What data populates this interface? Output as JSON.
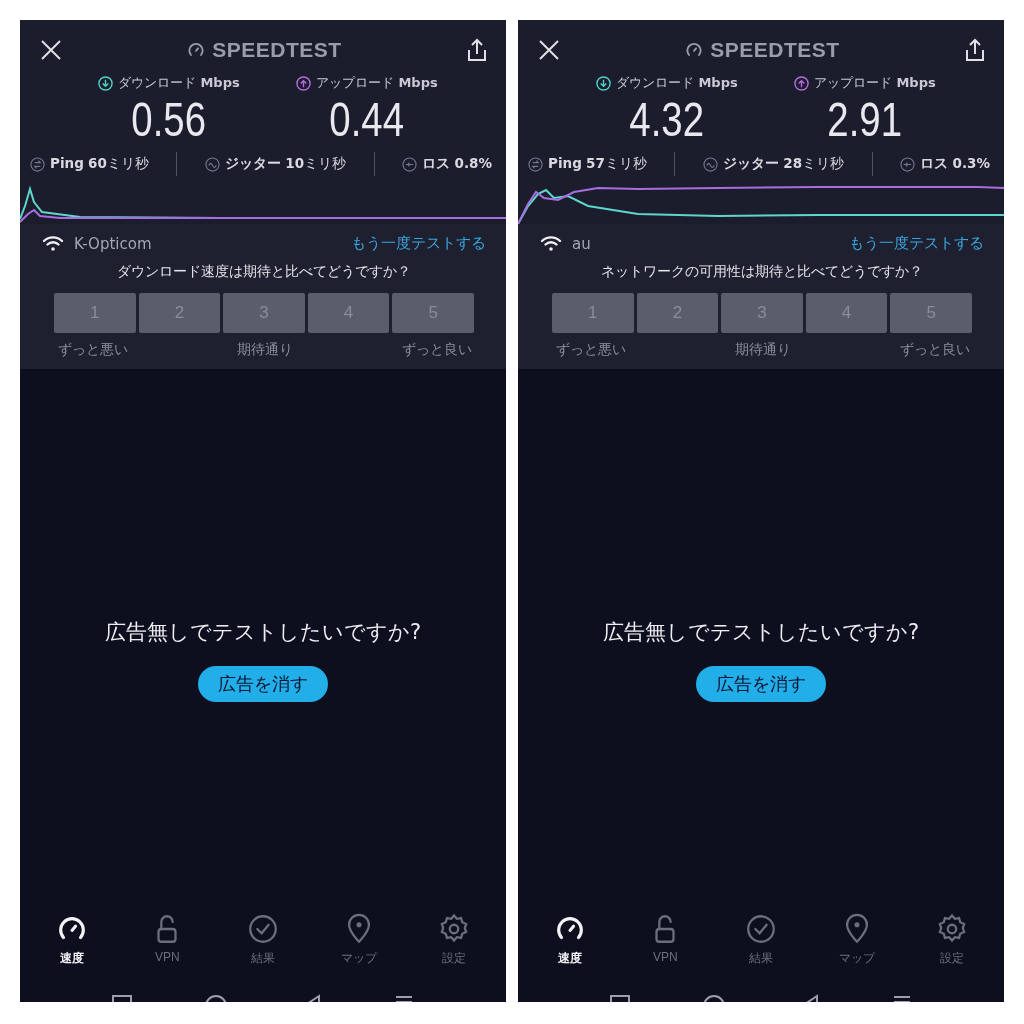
{
  "screens": [
    {
      "title": "SPEEDTEST",
      "download": {
        "label": "ダウンロード",
        "unit": "Mbps",
        "value": "0.56"
      },
      "upload": {
        "label": "アップロード",
        "unit": "Mbps",
        "value": "0.44"
      },
      "stats": [
        {
          "label": "Ping",
          "value": "**60**ミリ秒"
        },
        {
          "label": "ジッター",
          "value": "**10**ミリ秒"
        },
        {
          "label": "ロス",
          "value": "**0.8%**"
        }
      ],
      "network": "K-Opticom",
      "retest": "もう一度テストする",
      "question": "ダウンロード速度は期待と比べてどうですか？",
      "ratings": [
        "1",
        "2",
        "3",
        "4",
        "5"
      ],
      "scale": [
        "ずっと悪い",
        "期待通り",
        "ずっと良い"
      ],
      "ad_prompt": "広告無しでテストしたいですか?",
      "ad_button": "広告を消す",
      "nav": [
        {
          "label": "速度",
          "selected": true
        },
        {
          "label": "VPN",
          "selected": false
        },
        {
          "label": "結果",
          "selected": false
        },
        {
          "label": "マップ",
          "selected": false
        },
        {
          "label": "設定",
          "selected": false
        }
      ]
    },
    {
      "title": "SPEEDTEST",
      "download": {
        "label": "ダウンロード",
        "unit": "Mbps",
        "value": "4.32"
      },
      "upload": {
        "label": "アップロード",
        "unit": "Mbps",
        "value": "2.91"
      },
      "stats": [
        {
          "label": "Ping",
          "value": "**57**ミリ秒"
        },
        {
          "label": "ジッター",
          "value": "**28**ミリ秒"
        },
        {
          "label": "ロス",
          "value": "**0.3%**"
        }
      ],
      "network": "au",
      "retest": "もう一度テストする",
      "question": "ネットワークの可用性は期待と比べてどうですか？",
      "ratings": [
        "1",
        "2",
        "3",
        "4",
        "5"
      ],
      "scale": [
        "ずっと悪い",
        "期待通り",
        "ずっと良い"
      ],
      "ad_prompt": "広告無しでテストしたいですか?",
      "ad_button": "広告を消す",
      "nav": [
        {
          "label": "速度",
          "selected": true
        },
        {
          "label": "VPN",
          "selected": false
        },
        {
          "label": "結果",
          "selected": false
        },
        {
          "label": "マップ",
          "selected": false
        },
        {
          "label": "設定",
          "selected": false
        }
      ]
    }
  ]
}
